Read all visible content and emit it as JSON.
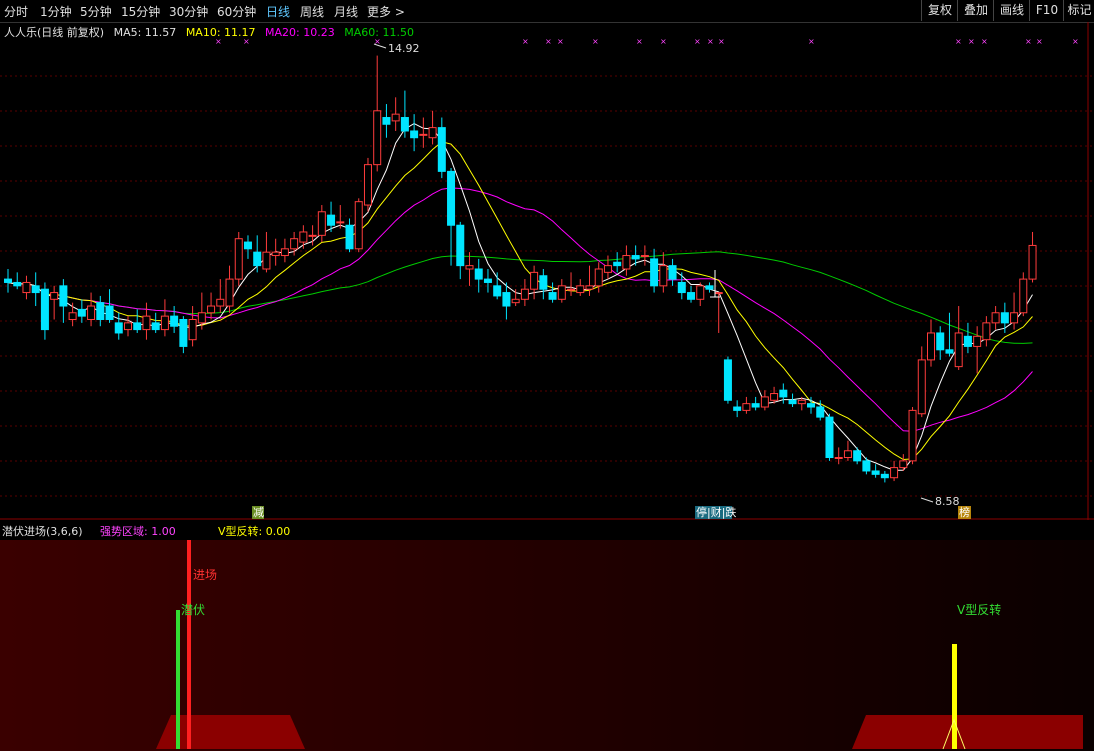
{
  "toolbar": {
    "tabs": [
      "分时",
      "1分钟",
      "5分钟",
      "15分钟",
      "30分钟",
      "60分钟",
      "日线",
      "周线",
      "月线",
      "更多 >"
    ],
    "active_tab": "日线",
    "right_buttons": [
      "复权",
      "叠加",
      "画线",
      "F10",
      "标记"
    ]
  },
  "chart_header": {
    "stock": "人人乐(日线 前复权)",
    "ma5": "MA5: 11.57",
    "ma10": "MA10: 11.17",
    "ma20": "MA20: 10.23",
    "ma60": "MA60: 11.50"
  },
  "colors": {
    "up": "#ff3c3c",
    "down": "#00e5ff",
    "ma5": "#ffffff",
    "ma10": "#ffff00",
    "ma20": "#ff00ff",
    "ma60": "#00cc00",
    "panel_line": "#8b0000"
  },
  "annotations": {
    "high_label": "14.92",
    "low_label": "8.58",
    "event_1": "减",
    "event_2": "停|财|跌",
    "event_3": "榜"
  },
  "indicator_header": {
    "name": "潜伏进场(3,6,6)",
    "strong_zone": "强势区域: 1.00",
    "v_reverse": "V型反转: 0.00"
  },
  "indicator_labels": {
    "entry": "进场",
    "lurk": "潜伏",
    "v_reverse": "V型反转"
  },
  "chart_data": {
    "type": "candlestick",
    "ylim": [
      8.2,
      15.3
    ],
    "candles": [
      [
        11.6,
        11.55,
        11.75,
        11.4
      ],
      [
        11.55,
        11.5,
        11.7,
        11.45
      ],
      [
        11.4,
        11.55,
        11.65,
        11.3
      ],
      [
        11.5,
        11.4,
        11.7,
        11.2
      ],
      [
        11.45,
        10.85,
        11.55,
        10.7
      ],
      [
        11.3,
        11.4,
        11.5,
        11.0
      ],
      [
        11.5,
        11.2,
        11.6,
        10.95
      ],
      [
        11.0,
        11.1,
        11.25,
        10.9
      ],
      [
        11.15,
        11.05,
        11.3,
        10.95
      ],
      [
        11.0,
        11.2,
        11.4,
        10.9
      ],
      [
        11.25,
        11.0,
        11.35,
        10.9
      ],
      [
        11.2,
        11.0,
        11.45,
        10.95
      ],
      [
        10.95,
        10.8,
        11.1,
        10.7
      ],
      [
        10.85,
        10.95,
        11.05,
        10.75
      ],
      [
        10.95,
        10.85,
        11.15,
        10.8
      ],
      [
        10.85,
        11.05,
        11.25,
        10.7
      ],
      [
        10.95,
        10.85,
        11.1,
        10.8
      ],
      [
        10.85,
        11.05,
        11.3,
        10.75
      ],
      [
        11.05,
        10.9,
        11.2,
        10.8
      ],
      [
        11.0,
        10.6,
        11.05,
        10.5
      ],
      [
        10.7,
        11.0,
        11.2,
        10.6
      ],
      [
        10.95,
        11.1,
        11.4,
        10.85
      ],
      [
        11.1,
        11.2,
        11.4,
        11.0
      ],
      [
        11.2,
        11.3,
        11.6,
        11.1
      ],
      [
        11.2,
        11.6,
        11.8,
        11.1
      ],
      [
        11.6,
        12.2,
        12.3,
        11.5
      ],
      [
        12.15,
        12.05,
        12.25,
        11.9
      ],
      [
        12.0,
        11.8,
        12.25,
        11.7
      ],
      [
        11.75,
        12.0,
        12.3,
        11.7
      ],
      [
        11.95,
        12.0,
        12.2,
        11.8
      ],
      [
        11.95,
        12.05,
        12.2,
        11.85
      ],
      [
        12.05,
        12.2,
        12.3,
        11.95
      ],
      [
        12.15,
        12.3,
        12.4,
        12.05
      ],
      [
        12.25,
        12.25,
        12.4,
        12.1
      ],
      [
        12.25,
        12.6,
        12.7,
        12.15
      ],
      [
        12.55,
        12.4,
        12.75,
        12.3
      ],
      [
        12.45,
        12.45,
        12.7,
        12.35
      ],
      [
        12.4,
        12.05,
        12.5,
        12.0
      ],
      [
        12.05,
        12.75,
        12.8,
        12.0
      ],
      [
        12.7,
        13.3,
        13.4,
        12.6
      ],
      [
        13.3,
        14.1,
        14.92,
        13.2
      ],
      [
        14.0,
        13.9,
        14.2,
        13.7
      ],
      [
        13.95,
        14.05,
        14.3,
        13.8
      ],
      [
        14.0,
        13.8,
        14.4,
        13.7
      ],
      [
        13.8,
        13.7,
        14.05,
        13.5
      ],
      [
        13.75,
        13.75,
        14.0,
        13.55
      ],
      [
        13.7,
        13.85,
        14.1,
        13.6
      ],
      [
        13.85,
        13.2,
        14.0,
        13.1
      ],
      [
        13.2,
        12.4,
        13.25,
        11.8
      ],
      [
        12.4,
        11.8,
        12.45,
        11.6
      ],
      [
        11.75,
        11.8,
        12.0,
        11.5
      ],
      [
        11.75,
        11.6,
        11.9,
        11.4
      ],
      [
        11.6,
        11.55,
        11.75,
        11.4
      ],
      [
        11.5,
        11.35,
        11.7,
        11.3
      ],
      [
        11.4,
        11.2,
        11.55,
        11.0
      ],
      [
        11.25,
        11.3,
        11.45,
        11.2
      ],
      [
        11.3,
        11.45,
        11.6,
        11.2
      ],
      [
        11.45,
        11.7,
        11.8,
        11.3
      ],
      [
        11.65,
        11.45,
        11.75,
        11.3
      ],
      [
        11.4,
        11.3,
        11.55,
        11.25
      ],
      [
        11.3,
        11.5,
        11.6,
        11.25
      ],
      [
        11.45,
        11.45,
        11.7,
        11.35
      ],
      [
        11.4,
        11.5,
        11.6,
        11.35
      ],
      [
        11.45,
        11.5,
        11.8,
        11.35
      ],
      [
        11.5,
        11.75,
        11.85,
        11.4
      ],
      [
        11.7,
        11.8,
        11.95,
        11.6
      ],
      [
        11.85,
        11.8,
        12.0,
        11.7
      ],
      [
        11.75,
        11.95,
        12.1,
        11.65
      ],
      [
        11.95,
        11.9,
        12.1,
        11.8
      ],
      [
        11.95,
        11.95,
        12.1,
        11.8
      ],
      [
        11.9,
        11.5,
        12.05,
        11.4
      ],
      [
        11.5,
        11.8,
        12.0,
        11.4
      ],
      [
        11.8,
        11.6,
        11.9,
        11.5
      ],
      [
        11.55,
        11.4,
        11.7,
        11.3
      ],
      [
        11.4,
        11.3,
        11.5,
        11.25
      ],
      [
        11.3,
        11.5,
        11.55,
        11.2
      ],
      [
        11.5,
        11.45,
        11.55,
        11.4
      ],
      [
        11.4,
        11.4,
        11.4,
        10.8
      ],
      [
        10.4,
        9.8,
        10.45,
        9.75
      ],
      [
        9.7,
        9.65,
        9.8,
        9.55
      ],
      [
        9.65,
        9.75,
        9.85,
        9.6
      ],
      [
        9.75,
        9.7,
        9.85,
        9.65
      ],
      [
        9.7,
        9.85,
        9.95,
        9.65
      ],
      [
        9.8,
        9.9,
        10.0,
        9.75
      ],
      [
        9.95,
        9.85,
        10.05,
        9.75
      ],
      [
        9.8,
        9.75,
        9.9,
        9.7
      ],
      [
        9.75,
        9.8,
        9.85,
        9.65
      ],
      [
        9.75,
        9.7,
        9.85,
        9.6
      ],
      [
        9.7,
        9.55,
        9.8,
        9.5
      ],
      [
        9.55,
        8.95,
        9.6,
        8.9
      ],
      [
        8.95,
        8.95,
        9.1,
        8.85
      ],
      [
        8.95,
        9.05,
        9.2,
        8.9
      ],
      [
        9.05,
        8.9,
        9.1,
        8.85
      ],
      [
        8.9,
        8.75,
        8.95,
        8.7
      ],
      [
        8.75,
        8.7,
        8.85,
        8.65
      ],
      [
        8.7,
        8.65,
        8.75,
        8.58
      ],
      [
        8.65,
        8.8,
        8.9,
        8.6
      ],
      [
        8.8,
        8.9,
        9.0,
        8.75
      ],
      [
        8.9,
        9.65,
        9.7,
        8.85
      ],
      [
        9.6,
        10.4,
        10.6,
        9.55
      ],
      [
        10.4,
        10.8,
        11.0,
        10.3
      ],
      [
        10.8,
        10.55,
        10.9,
        10.4
      ],
      [
        10.55,
        10.5,
        11.1,
        10.45
      ],
      [
        10.3,
        10.8,
        11.2,
        10.25
      ],
      [
        10.75,
        10.6,
        10.95,
        10.5
      ],
      [
        10.6,
        10.75,
        10.9,
        10.2
      ],
      [
        10.7,
        10.95,
        11.05,
        10.6
      ],
      [
        10.95,
        11.1,
        11.2,
        10.85
      ],
      [
        11.1,
        10.95,
        11.25,
        10.8
      ],
      [
        10.95,
        11.1,
        11.4,
        10.85
      ],
      [
        11.1,
        11.6,
        11.7,
        11.05
      ],
      [
        11.6,
        12.1,
        12.3,
        11.55
      ]
    ]
  }
}
